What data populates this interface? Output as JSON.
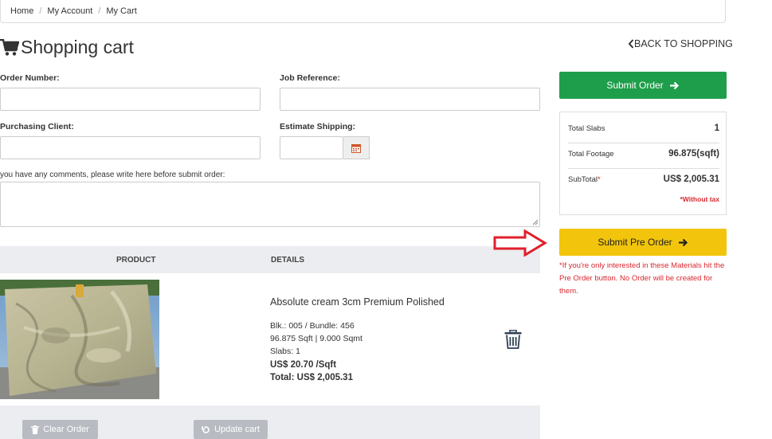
{
  "breadcrumb": {
    "items": [
      "Home",
      "My Account",
      "My Cart"
    ],
    "separator": "/"
  },
  "page": {
    "title": "Shopping cart",
    "back_label": "BACK TO SHOPPING"
  },
  "form": {
    "order_number_label": "Order Number:",
    "job_reference_label": "Job Reference:",
    "purchasing_client_label": "Purchasing Client:",
    "estimate_shipping_label": "Estimate Shipping:",
    "comments_label": "you have any comments, please write here before submit order:"
  },
  "table": {
    "col_product": "PRODUCT",
    "col_details": "DETAILS"
  },
  "item": {
    "name": "Absolute cream 3cm Premium Polished",
    "blk_bundle": "Blk.: 005 / Bundle: 456",
    "size": "96.875 Sqft | 9.000 Sqmt",
    "slabs": "Slabs: 1",
    "price": "US$ 20.70 /Sqft",
    "total": "Total: US$ 2,005.31"
  },
  "actions": {
    "clear_label": "Clear Order",
    "update_label": "Update cart"
  },
  "summary": {
    "submit_label": "Submit Order",
    "total_slabs_label": "Total Slabs",
    "total_slabs": "1",
    "total_footage_label": "Total Footage",
    "total_footage": "96.875(sqft)",
    "subtotal_label": "SubTotal",
    "subtotal_star": "*",
    "subtotal": "US$ 2,005.31",
    "without_tax": "*Without tax"
  },
  "preorder": {
    "label": "Submit Pre Order",
    "note": "*If you're only interested in these Materials hit the Pre Order button. No Order will be created for them."
  },
  "colors": {
    "green": "#1e9e4a",
    "yellow": "#f2c50c",
    "red": "#d9272e"
  }
}
